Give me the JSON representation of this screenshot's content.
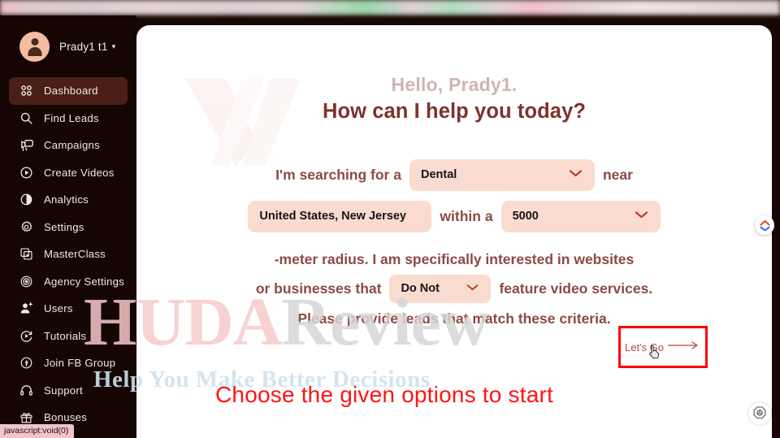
{
  "browser": {
    "toolbar_blurred": true
  },
  "sidebar": {
    "user": {
      "name": "Prady1 t1",
      "caret": "▾",
      "avatar_icon": "user-avatar-icon"
    },
    "items": [
      {
        "label": "Dashboard",
        "icon": "grid-icon",
        "active": true
      },
      {
        "label": "Find Leads",
        "icon": "search-icon",
        "active": false
      },
      {
        "label": "Campaigns",
        "icon": "megaphone-icon",
        "active": false
      },
      {
        "label": "Create Videos",
        "icon": "play-circle-icon",
        "active": false
      },
      {
        "label": "Analytics",
        "icon": "pie-chart-icon",
        "active": false
      },
      {
        "label": "Settings",
        "icon": "gear-icon",
        "active": false
      },
      {
        "label": "MasterClass",
        "icon": "video-stack-icon",
        "active": false
      },
      {
        "label": "Agency Settings",
        "icon": "target-gear-icon",
        "active": false
      },
      {
        "label": "Users",
        "icon": "user-add-icon",
        "active": false
      },
      {
        "label": "Tutorials",
        "icon": "play-refresh-icon",
        "active": false
      },
      {
        "label": "Join FB Group",
        "icon": "facebook-icon",
        "active": false
      },
      {
        "label": "Support",
        "icon": "headset-icon",
        "active": false
      },
      {
        "label": "Bonuses",
        "icon": "gift-icon",
        "active": false
      }
    ]
  },
  "main": {
    "greeting": "Hello, Prady1.",
    "headline": "How can I help you today?",
    "prompt": {
      "text_searching_for": "I'm searching for a",
      "text_near": "near",
      "text_within_a": "within a",
      "text_meter_radius": "-meter radius. I am specifically interested in websites",
      "text_or_businesses": "or businesses that",
      "text_feature_video": "feature video services.",
      "text_please_provide": "Please provide leads that match these criteria."
    },
    "fields": {
      "category": {
        "value": "Dental",
        "chevron": "chevron-down-icon"
      },
      "location": {
        "value": "United States, New Jersey"
      },
      "radius": {
        "value": "5000",
        "chevron": "chevron-down-icon"
      },
      "feature": {
        "value": "Do Not",
        "chevron": "chevron-down-icon"
      }
    },
    "cta": {
      "label": "Let's Go",
      "arrow": "long-arrow-right-icon"
    }
  },
  "annotation": {
    "caption": "Choose the given options to start",
    "highlight_color": "#ff0000",
    "caption_color": "#ff1414",
    "cursor_icon": "hand-pointer-cursor"
  },
  "watermark": {
    "brand_part1": "HUDA",
    "brand_part2": "Review",
    "tagline": "Help You Make Better Decisions",
    "logo_icon": "brand-w-logo-icon"
  },
  "widgets": {
    "top_right": {
      "icon": "colored-chevron-widget-icon"
    },
    "bottom_right": {
      "icon": "openai-logo-icon"
    }
  },
  "statusbar": {
    "text": "javascript:void(0)"
  },
  "colors": {
    "sidebar_bg": "#150604",
    "active_nav": "#4a1f17",
    "field_bg": "#fadbcf",
    "headline": "#7d332e",
    "prompt_text": "#8c4a45",
    "greeting": "#cfb4b3"
  }
}
